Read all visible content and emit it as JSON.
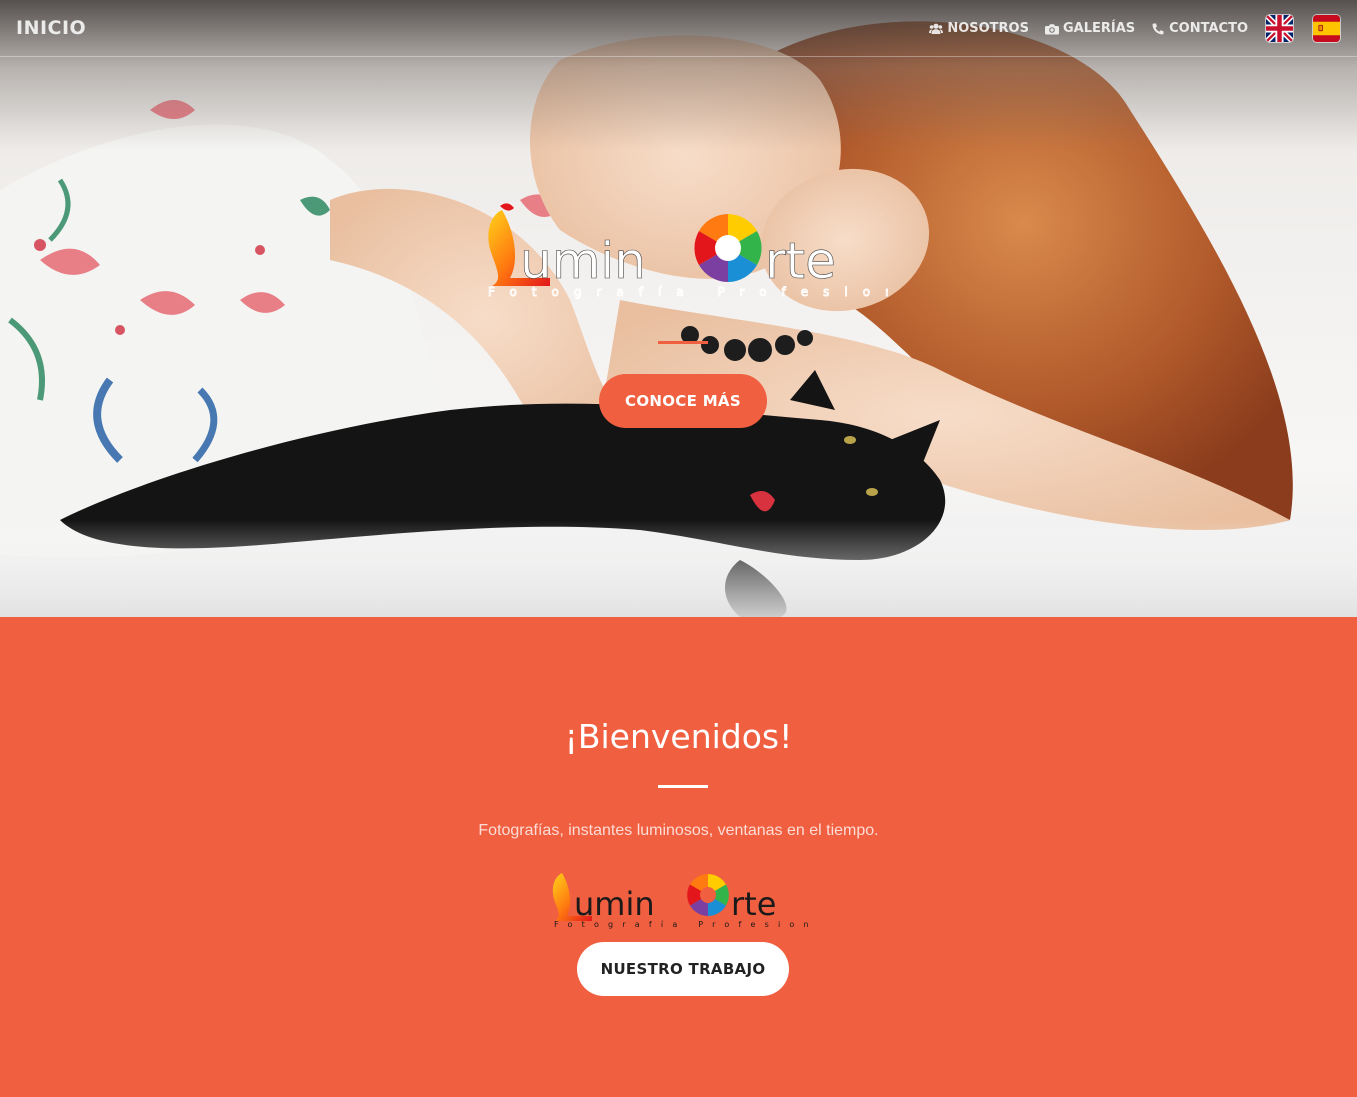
{
  "navbar": {
    "brand": "INICIO",
    "links": [
      {
        "label": "NOSOTROS",
        "icon": "users-icon"
      },
      {
        "label": "GALERÍAS",
        "icon": "camera-icon"
      },
      {
        "label": "CONTACTO",
        "icon": "phone-icon"
      }
    ],
    "flags": [
      "uk-flag-icon",
      "spain-flag-icon"
    ]
  },
  "hero": {
    "logo": {
      "wordmark": "LuminArte",
      "tagline": "Fotografía Profesional"
    },
    "button_label": "CONOCE MÁS"
  },
  "welcome": {
    "title": "¡Bienvenidos!",
    "text": "Fotografías, instantes luminosos, ventanas en el tiempo.",
    "logo": {
      "wordmark": "LuminArte",
      "tagline": "Fotografía Profesional"
    },
    "button_label": "NUESTRO TRABAJO"
  },
  "colors": {
    "accent": "#f05f40",
    "white": "#ffffff",
    "dark_text": "#222222"
  }
}
